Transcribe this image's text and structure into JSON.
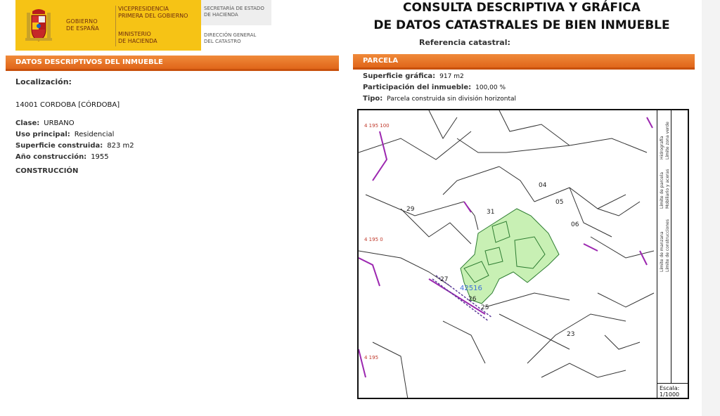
{
  "header": {
    "gov_line1": "GOBIERNO",
    "gov_line2": "DE ESPAÑA",
    "vice_line1": "VICEPRESIDENCIA",
    "vice_line2": "PRIMERA DEL GOBIERNO",
    "min_line1": "MINISTERIO",
    "min_line2": "DE HACIENDA",
    "sec_line1": "SECRETARÍA DE ESTADO",
    "sec_line2": "DE HACIENDA",
    "dir_line1": "DIRECCIÓN GENERAL",
    "dir_line2": "DEL CATASTRO",
    "title_line1": "CONSULTA DESCRIPTIVA Y GRÁFICA",
    "title_line2": "DE DATOS CATASTRALES DE BIEN INMUEBLE",
    "ref_label": "Referencia catastral:",
    "escudo_icon": "coat-of-arms-icon"
  },
  "left": {
    "bar_title": "DATOS DESCRIPTIVOS DEL INMUEBLE",
    "loc_label": "Localización:",
    "loc_value": "14001 CORDOBA [CÓRDOBA]",
    "clase_k": "Clase:",
    "clase_v": "URBANO",
    "uso_k": "Uso principal:",
    "uso_v": "Residencial",
    "sup_k": "Superficie construida:",
    "sup_v": "823 m2",
    "anio_k": "Año construcción:",
    "anio_v": "1955",
    "constr_label": "CONSTRUCCIÓN"
  },
  "right": {
    "bar_title": "PARCELA",
    "supg_k": "Superficie gráfica:",
    "supg_v": "917 m2",
    "part_k": "Participación del inmueble:",
    "part_v": "100,00 %",
    "tipo_k": "Tipo:",
    "tipo_v": "Parcela construida sin división horizontal"
  },
  "map": {
    "coord_top": "4 195 100",
    "coord_mid": "4 195 0",
    "coord_bot": "4 195",
    "parcel_numbers": [
      "04",
      "05",
      "06",
      "29",
      "31",
      "27",
      "26",
      "25",
      "23"
    ],
    "parcel_ref": "42516",
    "legend_1": "Límite de manzana",
    "legend_2": "Límite de parcela",
    "legend_3": "Hidrografía",
    "legend_4": "Límite de construcciones",
    "legend_5": "Mobiliario y aceras",
    "legend_6": "Límite zona verde",
    "scale_label": "Escala:",
    "scale_value": "1/1000",
    "colors": {
      "parcel_fill": "#c8f0b4",
      "parcel_stroke": "#2e7d32",
      "magenta": "#9c27b0",
      "coord": "#c0392b"
    }
  }
}
